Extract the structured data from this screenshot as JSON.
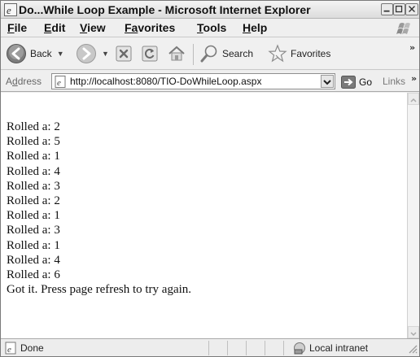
{
  "window": {
    "title": "Do...While Loop Example - Microsoft Internet Explorer"
  },
  "menu": {
    "items": [
      {
        "first": "F",
        "rest": "ile"
      },
      {
        "first": "E",
        "rest": "dit"
      },
      {
        "first": "V",
        "rest": "iew"
      },
      {
        "first": "Fa",
        "rest": "vorites"
      },
      {
        "first": "T",
        "rest": "ools"
      },
      {
        "first": "H",
        "rest": "elp"
      }
    ]
  },
  "toolbar": {
    "back_label": "Back",
    "search_label": "Search",
    "favorites_label": "Favorites",
    "chevron": "»"
  },
  "address": {
    "label_first": "d",
    "label_a": "A",
    "label_rest": "dress",
    "url": "http://localhost:8080/TIO-DoWhileLoop.aspx",
    "go_label": "Go",
    "links_label": "Links",
    "links_chevron": "»"
  },
  "content": {
    "lines": [
      "Rolled a: 2",
      "Rolled a: 5",
      "Rolled a: 1",
      "Rolled a: 4",
      "Rolled a: 3",
      "Rolled a: 2",
      "Rolled a: 1",
      "Rolled a: 3",
      "Rolled a: 1",
      "Rolled a: 4",
      "Rolled a: 6",
      "Got it. Press page refresh to try again."
    ]
  },
  "status": {
    "text": "Done",
    "zone": "Local intranet"
  },
  "icons": {
    "ie_logo": "ie-logo-icon",
    "back": "back-arrow-icon",
    "forward": "forward-arrow-icon",
    "stop": "stop-icon",
    "refresh": "refresh-icon",
    "home": "home-icon",
    "search": "search-icon",
    "favorites": "favorites-star-icon",
    "go": "go-arrow-icon",
    "zone": "local-intranet-icon"
  },
  "colors": {
    "back_button": "#3d8a2f",
    "go_button": "#2f8a2f",
    "window_chrome": "#ededed"
  }
}
